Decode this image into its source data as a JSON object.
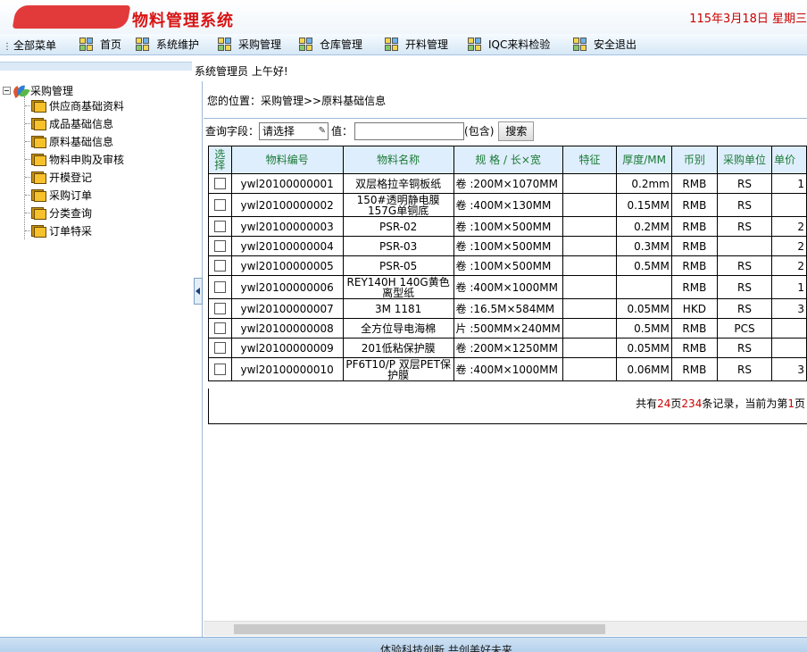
{
  "header": {
    "title": "物料管理系统",
    "date": "115年3月18日 星期三"
  },
  "menubar": {
    "all_menu": "全部菜单",
    "items": [
      "首页",
      "系统维护",
      "采购管理",
      "仓库管理",
      "开料管理",
      "IQC来料检验",
      "安全退出"
    ]
  },
  "welcome": "系统管理员 上午好!",
  "sidebar": {
    "root": "采购管理",
    "items": [
      "供应商基础资料",
      "成品基础信息",
      "原料基础信息",
      "物料申购及审核",
      "开模登记",
      "采购订单",
      "分类查询",
      "订单特采"
    ]
  },
  "main": {
    "location": "您的位置：采购管理>>原料基础信息",
    "query": {
      "field_label": "查询字段：",
      "field_value": "请选择",
      "value_label": "值：",
      "value_input": "",
      "contains_label": "(包含)",
      "search_button": "搜索"
    },
    "table": {
      "columns": [
        "选择",
        "物料编号",
        "物料名称",
        "规 格 / 长×宽",
        "特征",
        "厚度/MM",
        "币别",
        "采购单位",
        "单价"
      ],
      "rows": [
        {
          "code": "ywl20100000001",
          "name": "双层格拉辛铜板纸",
          "spec": "卷 :200M×1070MM",
          "feature": "",
          "thickness": "0.2mm",
          "currency": "RMB",
          "unit": "RS",
          "price": "1"
        },
        {
          "code": "ywl20100000002",
          "name": "150#透明静电膜157G单铜底",
          "spec": "卷 :400M×130MM",
          "feature": "",
          "thickness": "0.15MM",
          "currency": "RMB",
          "unit": "RS",
          "price": ""
        },
        {
          "code": "ywl20100000003",
          "name": "PSR-02",
          "spec": "卷 :100M×500MM",
          "feature": "",
          "thickness": "0.2MM",
          "currency": "RMB",
          "unit": "RS",
          "price": "2"
        },
        {
          "code": "ywl20100000004",
          "name": "PSR-03",
          "spec": "卷 :100M×500MM",
          "feature": "",
          "thickness": "0.3MM",
          "currency": "RMB",
          "unit": "",
          "price": "2"
        },
        {
          "code": "ywl20100000005",
          "name": "PSR-05",
          "spec": "卷 :100M×500MM",
          "feature": "",
          "thickness": "0.5MM",
          "currency": "RMB",
          "unit": "RS",
          "price": "2"
        },
        {
          "code": "ywl20100000006",
          "name": "REY140H 140G黄色离型纸",
          "spec": "卷 :400M×1000MM",
          "feature": "",
          "thickness": "",
          "currency": "RMB",
          "unit": "RS",
          "price": "1"
        },
        {
          "code": "ywl20100000007",
          "name": "3M 1181",
          "spec": "卷 :16.5M×584MM",
          "feature": "",
          "thickness": "0.05MM",
          "currency": "HKD",
          "unit": "RS",
          "price": "3"
        },
        {
          "code": "ywl20100000008",
          "name": "全方位导电海棉",
          "spec": "片 :500MM×240MM",
          "feature": "",
          "thickness": "0.5MM",
          "currency": "RMB",
          "unit": "PCS",
          "price": ""
        },
        {
          "code": "ywl20100000009",
          "name": "201低粘保护膜",
          "spec": "卷 :200M×1250MM",
          "feature": "",
          "thickness": "0.05MM",
          "currency": "RMB",
          "unit": "RS",
          "price": ""
        },
        {
          "code": "ywl20100000010",
          "name": "PF6T10/P 双层PET保护膜",
          "spec": "卷 :400M×1000MM",
          "feature": "",
          "thickness": "0.06MM",
          "currency": "RMB",
          "unit": "RS",
          "price": "3"
        }
      ]
    },
    "pager": {
      "prefix": "共有",
      "pages": "24",
      "mid1": "页",
      "records": "234",
      "mid2": "条记录，当前为第",
      "current": "1",
      "suffix": "页"
    }
  },
  "footer": "体验科技创新 共创美好未来"
}
